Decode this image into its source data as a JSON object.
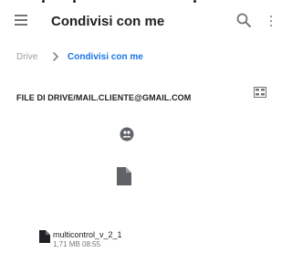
{
  "icons": {
    "menu": "menu-icon",
    "search": "search-icon",
    "overflow": "more-vert-icon",
    "breadcrumb_separator": "chevron-right-icon",
    "view_toggle": "grid-view-icon",
    "shared_badge": "shared-badge-icon",
    "file_type": "document-icon"
  },
  "colors": {
    "accent": "#1a73e8",
    "icon_gray": "#757575",
    "muted_text": "#9aa0a6",
    "file_icon": "#5f6368"
  },
  "appbar": {
    "title": "Condivisi con me"
  },
  "breadcrumb": {
    "root": "Drive",
    "current": "Condivisi con me"
  },
  "section": {
    "title": "FILE DI DRIVE/MAIL.CLIENTE@GMAIL.COM"
  },
  "files": [
    {
      "name": "multicontrol_v_2_1",
      "meta": "1,71 MB 08:55"
    }
  ]
}
